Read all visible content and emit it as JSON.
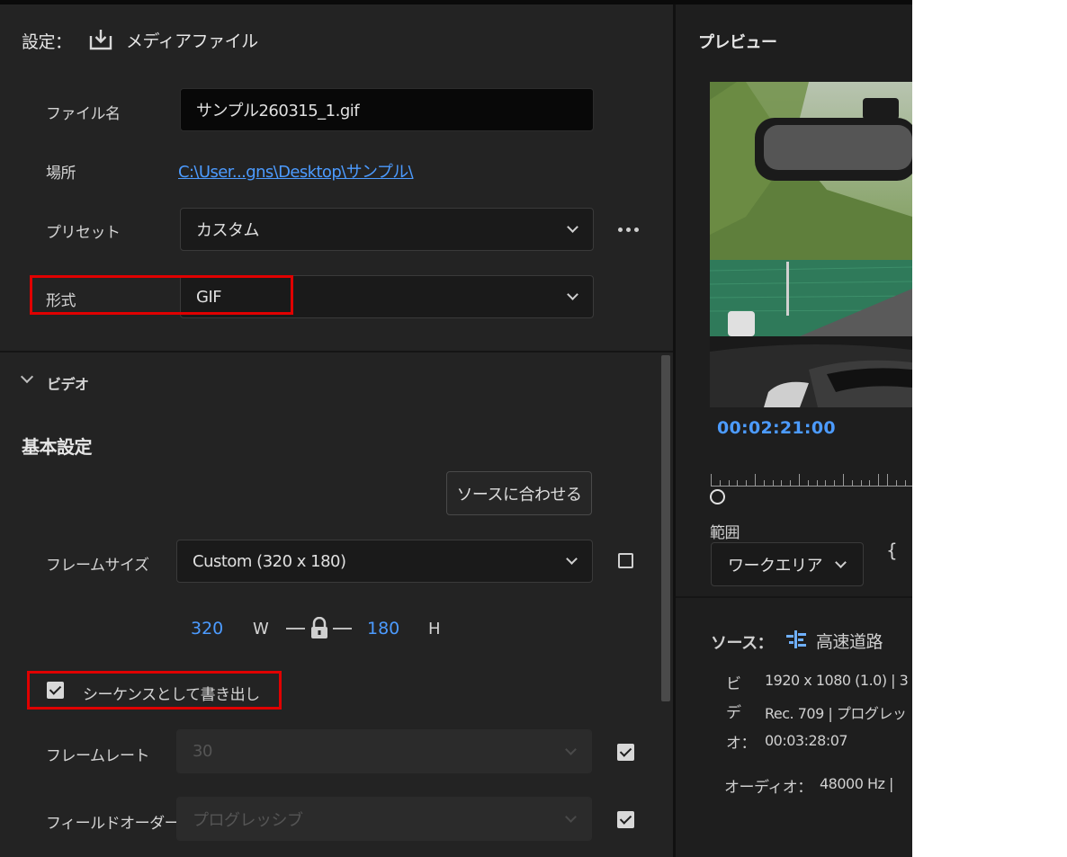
{
  "settings": {
    "title": "設定：",
    "media_label": "メディアファイル",
    "filename_label": "ファイル名",
    "filename_value": "サンプル260315_1.gif",
    "location_label": "場所",
    "location_value": "C:\\User...gns\\Desktop\\サンプル\\",
    "preset_label": "プリセット",
    "preset_value": "カスタム",
    "format_label": "形式",
    "format_value": "GIF"
  },
  "video": {
    "section_label": "ビデオ",
    "basic_heading": "基本設定",
    "match_source_button": "ソースに合わせる",
    "frame_size_label": "フレームサイズ",
    "frame_size_value": "Custom (320 x 180)",
    "width_value": "320",
    "width_unit": "W",
    "height_value": "180",
    "height_unit": "H",
    "export_sequence_label": "シーケンスとして書き出し",
    "frame_rate_label": "フレームレート",
    "frame_rate_value": "30",
    "field_order_label": "フィールドオーダー",
    "field_order_value": "プログレッシブ"
  },
  "preview": {
    "title": "プレビュー",
    "timecode": "00:02:21:00",
    "range_label": "範囲",
    "range_value": "ワークエリア",
    "source_label": "ソース：",
    "source_name": "高速道路",
    "row1_prefix": "ビ",
    "row1_value": "1920 x 1080 (1.0) | 3",
    "row2_prefix": "デ",
    "row2_value": "Rec. 709 | プログレッ",
    "row3_prefix": "オ：",
    "row3_value": "00:03:28:07",
    "audio_label": "オーディオ：",
    "audio_value": "48000 Hz |"
  },
  "colors": {
    "accent": "#4c9bff",
    "highlight": "#e00000",
    "panel": "#232323"
  }
}
